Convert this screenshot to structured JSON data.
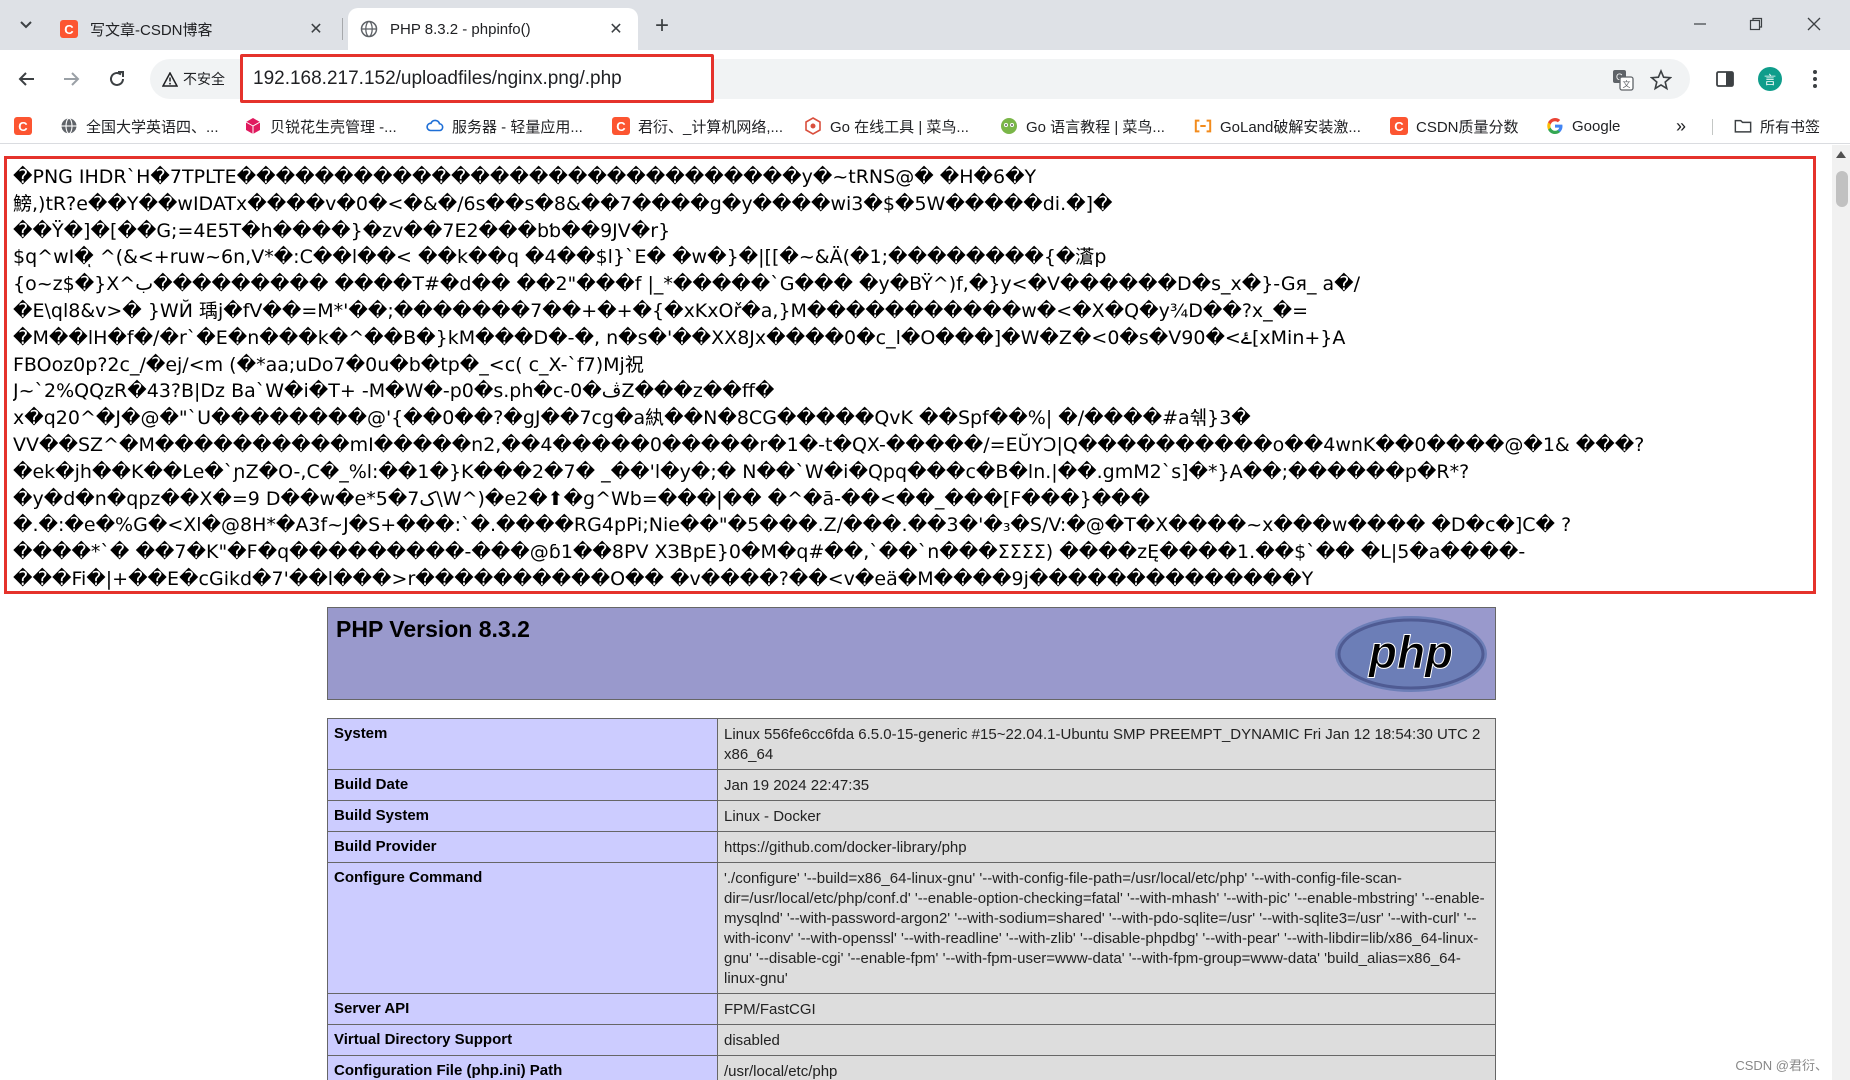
{
  "tabs": [
    {
      "title": "写文章-CSDN博客",
      "close": "✕"
    },
    {
      "title": "PHP 8.3.2 - phpinfo()",
      "close": "✕"
    }
  ],
  "new_tab": "+",
  "address": {
    "security_label": "不安全",
    "url": "192.168.217.152/uploadfiles/nginx.png/.php"
  },
  "profile_initial": "言",
  "bookmarks": [
    {
      "label": "",
      "icon": "csdn-icon"
    },
    {
      "label": "全国大学英语四、...",
      "icon": "globe-icon"
    },
    {
      "label": "贝锐花生壳管理 -...",
      "icon": "cube-icon"
    },
    {
      "label": "服务器 - 轻量应用...",
      "icon": "cloud-icon"
    },
    {
      "label": "君衍、_计算机网络,...",
      "icon": "csdn-icon"
    },
    {
      "label": "Go 在线工具 | 菜鸟...",
      "icon": "tool-icon"
    },
    {
      "label": "Go 语言教程 | 菜鸟...",
      "icon": "runoob-icon"
    },
    {
      "label": "GoLand破解安装激...",
      "icon": "bracket-icon"
    },
    {
      "label": "CSDN质量分数",
      "icon": "csdn-icon"
    },
    {
      "label": "Google",
      "icon": "google-icon"
    }
  ],
  "bookmarks_overflow": "»",
  "all_bookmarks": "所有书签",
  "garbage_lines": [
    "�PNG  IHDR`H�7TPLTE�����������������������������y�~tRNS@� �H�6�Y",
    "鰟,)tR?e��Y��wIDATx����v�0�<�&�/6s��s�8&��7����g�y����wi3�$�5W�����di.�]�",
    "��Ÿ�]�[��G;=4E5T�h����}�zv��7E2���bƅ��9JV�r}",
    "$q^wI�ͅ ^(&<+ruw~6n,V*�:C��l��< ��k��q �4��$l}`E� �w�}�|[[�~&Ä(�1;��������{�濸p",
    "{o~z$�}X^ب��������� ����T#�d�� ��2\"���f |_*�����`G��� �y�BŸ^)f,�}y<�V������D�s_x�}-Gя_ a�/",
    "�E\\ql8&v>� }WЙ 瑀j�fV��=M*'��;�������7��+�+�{�xKxOř�a,}M�����������w�<�X�Q�y¾D��?x_�=",
    "�M��lH�f�/�r`�E�n���k�^��B�}kM���D�-�, n�s�'��XX8Jx����0�c_l�O���]�W�Z�<0�s�V90�<ۓ[xMin+}A",
    "FBOoz0p?2c_/�ej/<m (�*aa;uDo7�0u�b�tp�_<c( c_X-`f7)Mj祝",
    "J~`2%QQzR�43?B|Dz BaˋW�i�T+ -M�W�-p0�s.ph�c-0�ڤZ���z��ff�",
    "x�q20^�J�@�\"`U��������@'{��0��?�gJ��7cg�a紈��N�8CG�����QvK ��Spf��%| �/����#a쉒}3�",
    "VV��SZ^�M����������mI�����n2,��4�����0�����r�1�-t�QX-�����/=EŬYƆ|Q����������o��4wnK��0����@�1& ���?",
    "�ek�jh��K��Le�`ɲZ�O-,C�_%l:��1�}K���2�7� _��'l�y�;� N��`W�i�Qpq���c�B�ln.|��.gmM2`s]�*}A��;������p�R*?",
    "�y�d�n�qpz��X�=9 D��w�e*5�7ک\\W^)�e2�⬆�g^Wb=���|�� �^�ā-��<��_���[F���}���",
    "�.�:�e�%G�<Xl�@8H*�A3f~J�S+���:`�.����RG4pPi;Nie��\"�5���.Z/���.��3�'�₃�S/V:�@�T�X����~x���w���� �D�c�]C� ?",
    "����*`� ��7�K\"�F�q���������-���@ɓ1��8PV XЗBpE}0�M�q#��,`��`n���ƩƩƩƩ) ����zĘ����1.��$`�� �L|5�a����-",
    "���Fi�|+��E�cGikd�7'��l���>r����������O�� �v����?��<v�eä�M����9j��������������Y"
  ],
  "php_version": "PHP Version 8.3.2",
  "php_logo_text": "php",
  "info_rows": [
    {
      "key": "System",
      "value": "Linux 556fe6cc6fda 6.5.0-15-generic #15~22.04.1-Ubuntu SMP PREEMPT_DYNAMIC Fri Jan 12 18:54:30 UTC 2 x86_64"
    },
    {
      "key": "Build Date",
      "value": "Jan 19 2024 22:47:35"
    },
    {
      "key": "Build System",
      "value": "Linux - Docker"
    },
    {
      "key": "Build Provider",
      "value": "https://github.com/docker-library/php"
    },
    {
      "key": "Configure Command",
      "value": "'./configure' '--build=x86_64-linux-gnu' '--with-config-file-path=/usr/local/etc/php' '--with-config-file-scan-dir=/usr/local/etc/php/conf.d' '--enable-option-checking=fatal' '--with-mhash' '--with-pic' '--enable-mbstring' '--enable-mysqlnd' '--with-password-argon2' '--with-sodium=shared' '--with-pdo-sqlite=/usr' '--with-sqlite3=/usr' '--with-curl' '--with-iconv' '--with-openssl' '--with-readline' '--with-zlib' '--disable-phpdbg' '--with-pear' '--with-libdir=lib/x86_64-linux-gnu' '--disable-cgi' '--enable-fpm' '--with-fpm-user=www-data' '--with-fpm-group=www-data' 'build_alias=x86_64-linux-gnu'"
    },
    {
      "key": "Server API",
      "value": "FPM/FastCGI"
    },
    {
      "key": "Virtual Directory Support",
      "value": "disabled"
    },
    {
      "key": "Configuration File (php.ini) Path",
      "value": "/usr/local/etc/php"
    }
  ],
  "watermark": "CSDN @君衍、",
  "colors": {
    "highlight_border": "#e5322b",
    "php_header": "#9999cc",
    "key_cell": "#ccccff",
    "value_cell": "#dddddd"
  }
}
